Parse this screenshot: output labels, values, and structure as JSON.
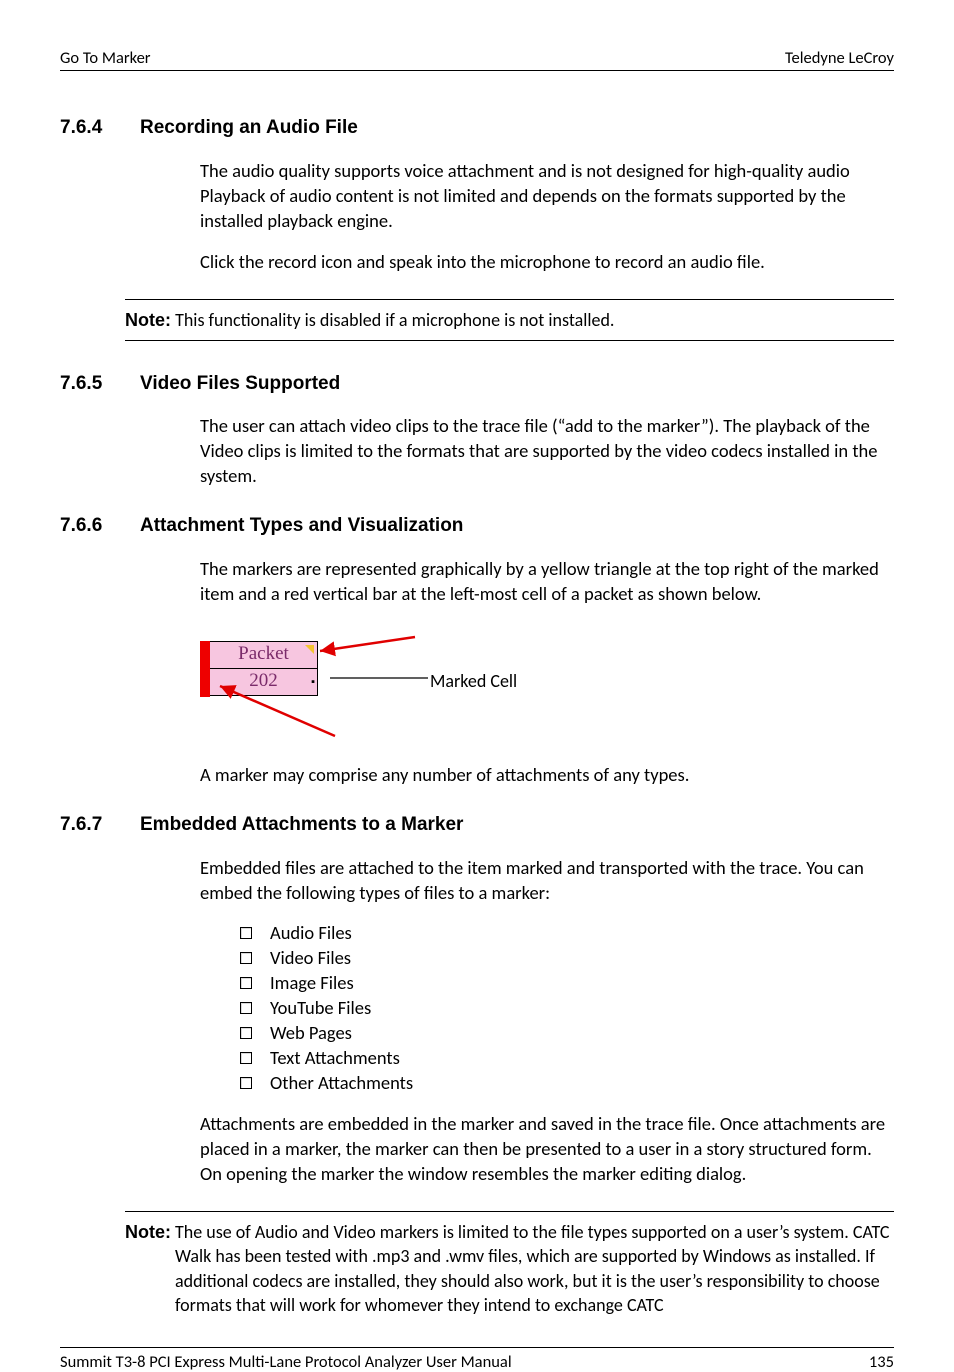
{
  "header": {
    "left": "Go To Marker",
    "right": "Teledyne  LeCroy"
  },
  "sections": {
    "s764": {
      "num": "7.6.4",
      "title": "Recording an Audio File",
      "p1": "The audio quality supports voice attachment and is not designed for high-quality audio Playback of audio content is not limited and depends on the formats supported by the installed playback engine.",
      "p2": "Click the record icon and speak into the microphone to record an audio file."
    },
    "note1": {
      "label": "Note:",
      "text": "This functionality is disabled if a microphone is not installed."
    },
    "s765": {
      "num": "7.6.5",
      "title": "Video Files Supported",
      "p1": "The user can attach video clips to the trace file (“add to the marker”). The playback of the Video clips is limited to the formats that are supported by the video codecs installed in the system."
    },
    "s766": {
      "num": "7.6.6",
      "title": "Attachment Types and Visualization",
      "p1": "The markers are represented graphically by a yellow triangle at the top right of the marked item and a red vertical bar at the left-most cell of a packet as shown below.",
      "fig": {
        "row1": "Packet",
        "row2": "202",
        "label": "Marked Cell"
      },
      "p2": "A marker may comprise any number of attachments of any types."
    },
    "s767": {
      "num": "7.6.7",
      "title": "Embedded Attachments to a Marker",
      "p1": "Embedded files are attached to the item marked and transported with the trace. You can embed the following types of files to a marker:",
      "list": {
        "i0": "Audio Files",
        "i1": "Video Files",
        "i2": "Image Files",
        "i3": "YouTube Files",
        "i4": "Web Pages",
        "i5": "Text Attachments",
        "i6": "Other Attachments"
      },
      "p2": "Attachments are embedded in the marker and saved in the trace file. Once attachments are placed in a marker, the marker can then be presented to a user in a story structured form. On opening the marker the window resembles the marker editing dialog."
    },
    "note2": {
      "label": "Note:",
      "text": "The use of Audio and Video markers is limited to the file types supported on a user’s system. CATC Walk has been tested with .mp3 and .wmv files, which are supported by Windows as installed. If additional codecs are installed, they should also work, but it is the user’s responsibility to choose formats that will work for whomever they intend to exchange CATC"
    }
  },
  "footer": {
    "left": "Summit T3-8 PCI Express Multi-Lane Protocol Analyzer User Manual",
    "right": "135"
  }
}
